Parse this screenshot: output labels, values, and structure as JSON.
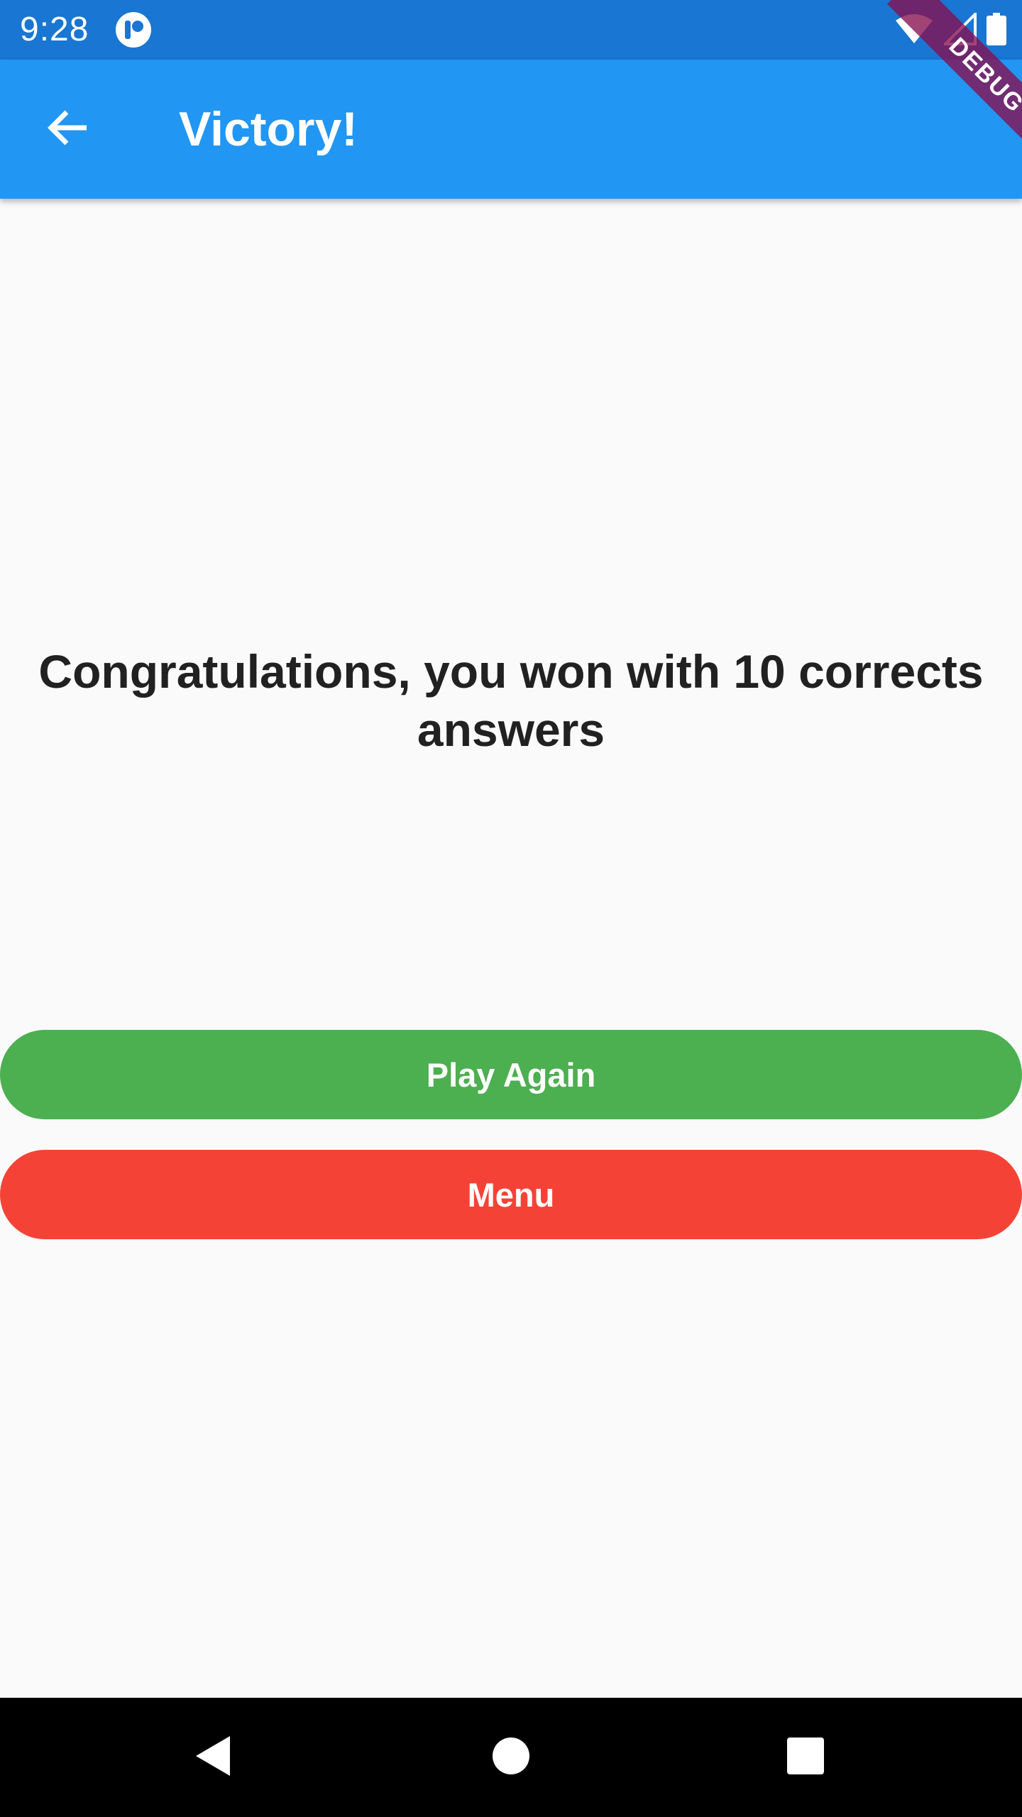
{
  "status_bar": {
    "time": "9:28",
    "notification_icon": "app-notification-icon",
    "icons": [
      "wifi-icon",
      "signal-icon",
      "battery-icon"
    ]
  },
  "app_bar": {
    "title": "Victory!",
    "back_icon": "arrow-back-icon"
  },
  "debug_banner": {
    "label": "DEBUG"
  },
  "main": {
    "message": "Congratulations, you won with 10 corrects answers"
  },
  "buttons": {
    "play_again": "Play Again",
    "menu": "Menu"
  },
  "nav_bar": {
    "icons": [
      "nav-back-icon",
      "nav-home-icon",
      "nav-recents-icon"
    ]
  },
  "colors": {
    "status_bar": "#1976d2",
    "app_bar": "#2196f3",
    "background": "#fafafa",
    "play_again": "#4caf50",
    "menu": "#f44336",
    "debug_ribbon": "#880e4f",
    "text": "#212121"
  }
}
